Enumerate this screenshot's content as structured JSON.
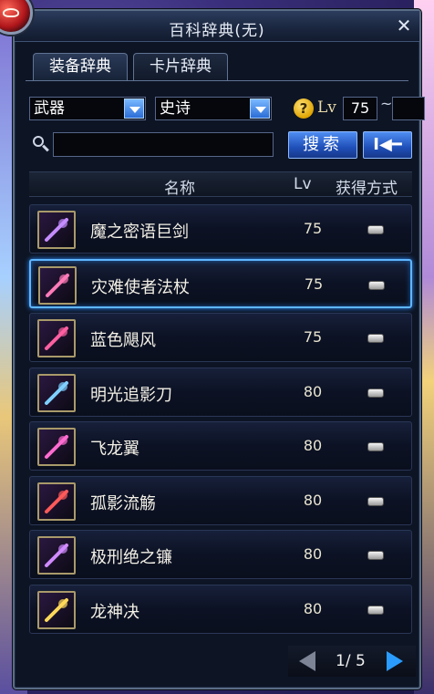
{
  "window": {
    "title": "百科辞典(无)",
    "close_label": "✕"
  },
  "tabs": [
    {
      "label": "装备辞典",
      "active": true
    },
    {
      "label": "卡片辞典",
      "active": false
    }
  ],
  "filters": {
    "type_value": "武器",
    "rarity_value": "史诗",
    "help_icon": "?",
    "lv_label": "Lv",
    "lv_min": "75",
    "lv_sep": "~",
    "lv_max": ""
  },
  "search": {
    "placeholder": "",
    "search_label": "搜索",
    "reset_label": "I◀━"
  },
  "columns": {
    "name": "名称",
    "lv": "Lv",
    "source": "获得方式"
  },
  "items": [
    {
      "name": "魔之密语巨剑",
      "lv": "75",
      "icon": "greatsword-icon",
      "selected": false
    },
    {
      "name": "灾难使者法杖",
      "lv": "75",
      "icon": "staff-icon",
      "selected": true
    },
    {
      "name": "蓝色飓风",
      "lv": "75",
      "icon": "whip-icon",
      "selected": false
    },
    {
      "name": "明光追影刀",
      "lv": "80",
      "icon": "katana-icon",
      "selected": false
    },
    {
      "name": "飞龙翼",
      "lv": "80",
      "icon": "wing-icon",
      "selected": false
    },
    {
      "name": "孤影流觞",
      "lv": "80",
      "icon": "gun-icon",
      "selected": false
    },
    {
      "name": "极刑绝之镰",
      "lv": "80",
      "icon": "scythe-icon",
      "selected": false
    },
    {
      "name": "龙神决",
      "lv": "80",
      "icon": "lance-icon",
      "selected": false
    }
  ],
  "pager": {
    "text": "1/ 5"
  }
}
